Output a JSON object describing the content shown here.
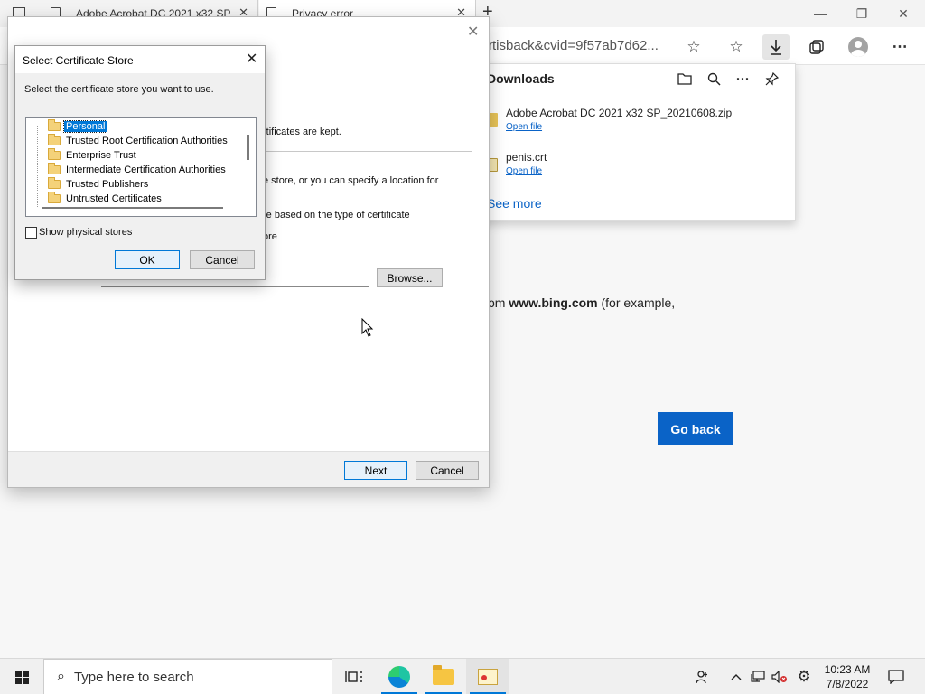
{
  "browser": {
    "tabs": [
      {
        "title": "Adobe Acrobat DC 2021 x32 SP",
        "close": "✕"
      },
      {
        "title": "Privacy error",
        "close": "✕"
      }
    ],
    "new_tab": "+",
    "window_controls": {
      "minimize": "—",
      "restore": "❐",
      "close": "✕"
    },
    "address_text": "rtisback&cvid=9f57ab7d62...",
    "toolbar_icons": [
      "favorite-add-icon",
      "favorites-icon",
      "downloads-icon",
      "collections-icon",
      "profile-icon",
      "more-icon"
    ]
  },
  "page": {
    "text_prefix": "om ",
    "text_bold": "www.bing.com",
    "text_suffix": " (for example,",
    "go_back": "Go back"
  },
  "downloads": {
    "title": "Downloads",
    "items": [
      {
        "name": "Adobe Acrobat DC 2021 x32 SP_20210608.zip",
        "action": "Open file"
      },
      {
        "name": "penis.crt",
        "action": "Open file"
      }
    ],
    "see_more": "See more"
  },
  "wizard": {
    "close": "✕",
    "line1": "rtificates are kept.",
    "line2": "e store, or you can specify a location for",
    "line3": "re based on the type of certificate",
    "line4": "ore",
    "browse": "Browse...",
    "next": "Next",
    "cancel": "Cancel"
  },
  "store_dialog": {
    "title": "Select Certificate Store",
    "close": "✕",
    "prompt": "Select the certificate store you want to use.",
    "stores": [
      "Personal",
      "Trusted Root Certification Authorities",
      "Enterprise Trust",
      "Intermediate Certification Authorities",
      "Trusted Publishers",
      "Untrusted Certificates"
    ],
    "selected_index": 0,
    "show_physical": "Show physical stores",
    "show_physical_checked": false,
    "ok": "OK",
    "cancel": "Cancel"
  },
  "taskbar": {
    "search_placeholder": "Type here to search",
    "time": "10:23 AM",
    "date": "7/8/2022"
  }
}
